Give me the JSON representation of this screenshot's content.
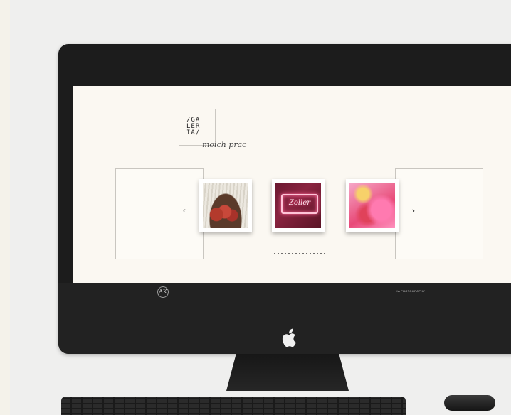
{
  "gallery": {
    "logo_lines": [
      "/GA",
      "LER",
      "IA/"
    ],
    "logo_script": "moich prac",
    "nav_prev": "‹",
    "nav_next": "›",
    "thumbnails": [
      {
        "name": "apples-photo"
      },
      {
        "name": "neon-sign-photo",
        "sign_text": "Zoller"
      },
      {
        "name": "pink-abstract-photo"
      }
    ],
    "pager_dot_count": 15
  },
  "bezel": {
    "logo_text": "AK",
    "caption": "KA PHOTOGRAPHY"
  },
  "colors": {
    "screen_background": "#fbf8f2",
    "bezel": "#1c1c1c"
  },
  "icons": {
    "apple": "apple-logo-icon"
  }
}
